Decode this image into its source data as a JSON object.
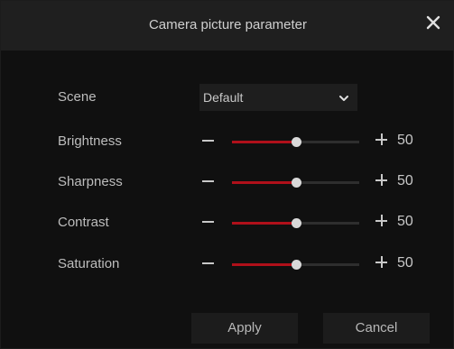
{
  "dialog": {
    "title": "Camera picture parameter",
    "close_icon": "close-icon"
  },
  "scene": {
    "label": "Scene",
    "value": "Default",
    "icon": "chevron-down-icon"
  },
  "sliders": [
    {
      "label": "Brightness",
      "value": "50",
      "fraction": 0.5
    },
    {
      "label": "Sharpness",
      "value": "50",
      "fraction": 0.5
    },
    {
      "label": "Contrast",
      "value": "50",
      "fraction": 0.5
    },
    {
      "label": "Saturation",
      "value": "50",
      "fraction": 0.5
    }
  ],
  "buttons": {
    "apply": "Apply",
    "cancel": "Cancel"
  },
  "colors": {
    "accent": "#b0101a",
    "background": "#101010",
    "titlebar": "#1f1f1f"
  }
}
